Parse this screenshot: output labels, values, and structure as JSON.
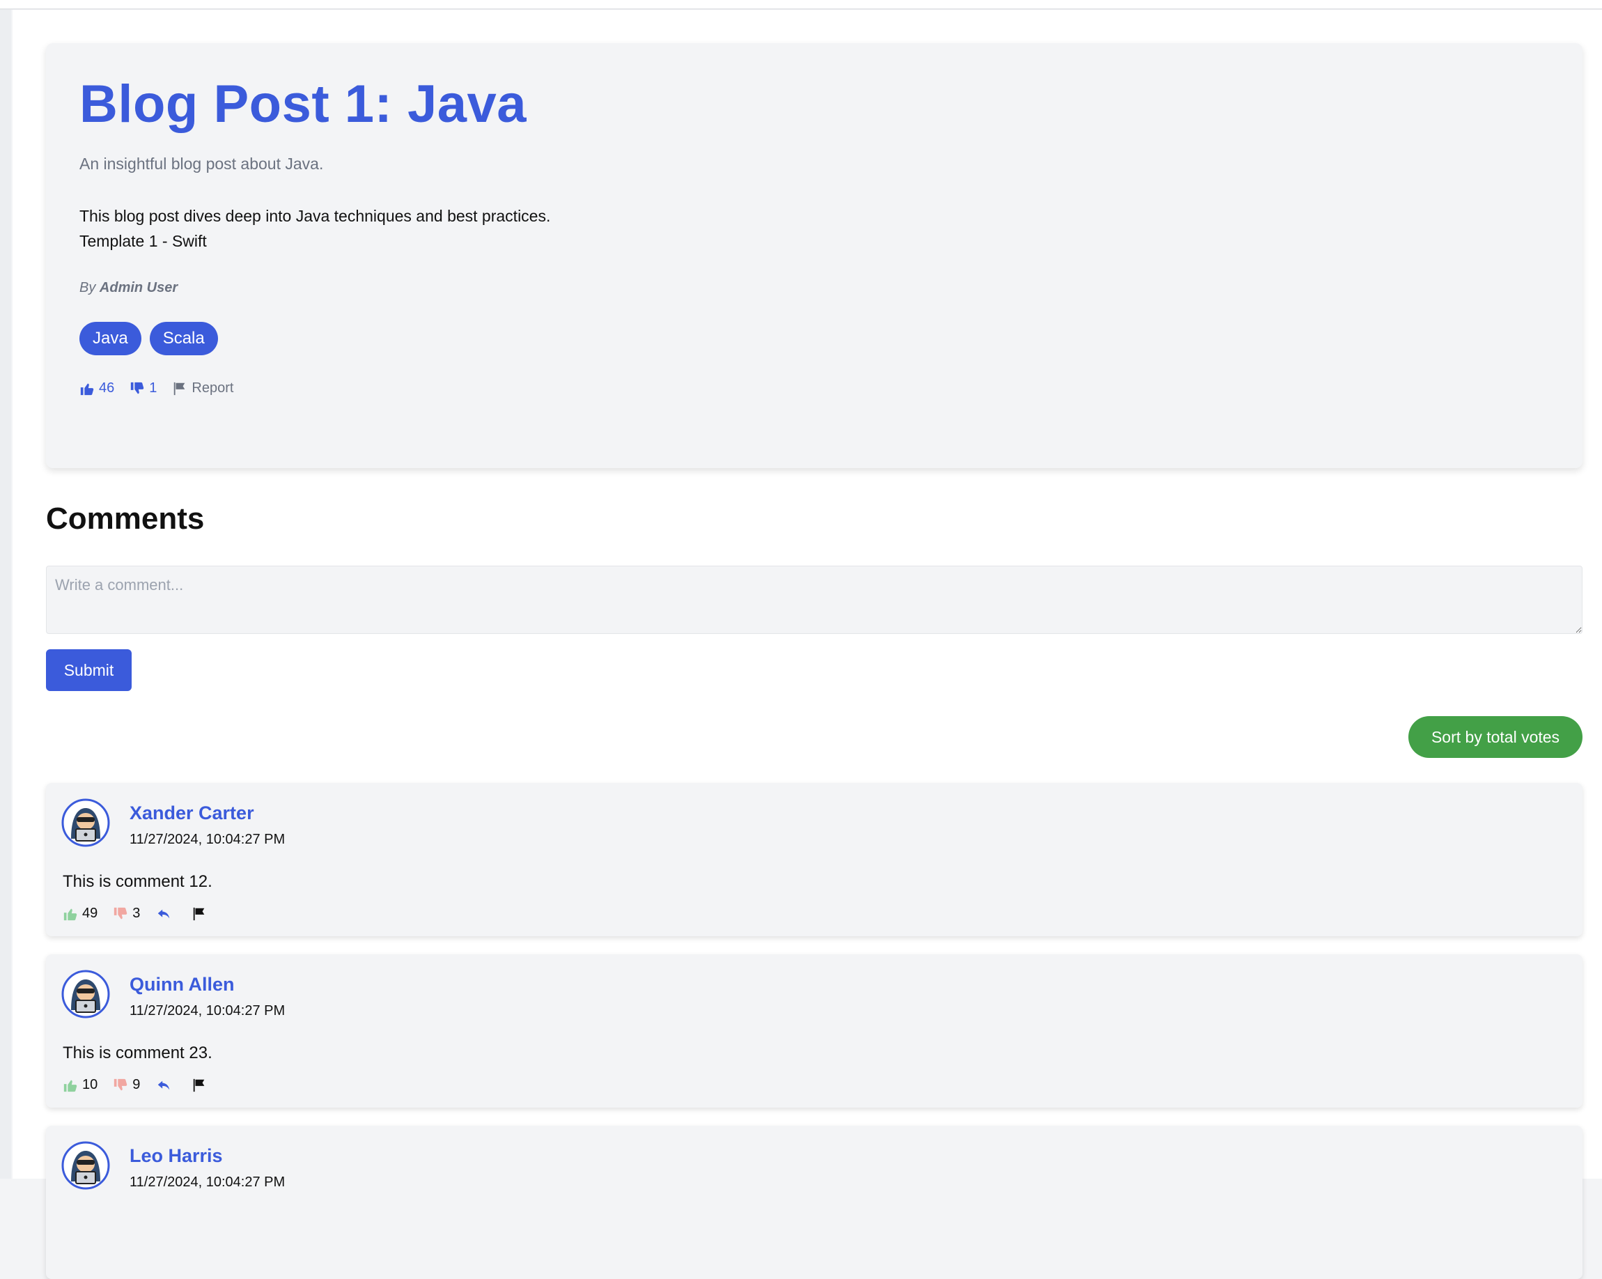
{
  "post": {
    "title": "Blog Post 1: Java",
    "subtitle": "An insightful blog post about Java.",
    "body_line1": "This blog post dives deep into Java techniques and best practices.",
    "body_line2": "Template 1 - Swift",
    "author_prefix": "By",
    "author_name": "Admin User",
    "tags": [
      "Java",
      "Scala"
    ],
    "upvotes": "46",
    "downvotes": "1",
    "report_label": "Report"
  },
  "comments_section": {
    "heading": "Comments",
    "input_placeholder": "Write a comment...",
    "input_value": "",
    "submit_label": "Submit",
    "sort_label": "Sort by total votes"
  },
  "comments": [
    {
      "author": "Xander Carter",
      "timestamp": "11/27/2024, 10:04:27 PM",
      "text": "This is comment 12.",
      "upvotes": "49",
      "downvotes": "3"
    },
    {
      "author": "Quinn Allen",
      "timestamp": "11/27/2024, 10:04:27 PM",
      "text": "This is comment 23.",
      "upvotes": "10",
      "downvotes": "9"
    },
    {
      "author": "Leo Harris",
      "timestamp": "11/27/2024, 10:04:27 PM",
      "text": "",
      "upvotes": "",
      "downvotes": ""
    }
  ],
  "colors": {
    "accent": "#3b5bdb",
    "sort_button": "#43a047",
    "card_bg": "#f3f4f6",
    "upvote_icon": "#8fd19e",
    "downvote_icon": "#f1a7a1"
  },
  "icons": {
    "upvote": "thumbs-up-icon",
    "downvote": "thumbs-down-icon",
    "report": "flag-icon",
    "reply": "reply-icon",
    "avatar": "hacker-avatar-icon"
  }
}
